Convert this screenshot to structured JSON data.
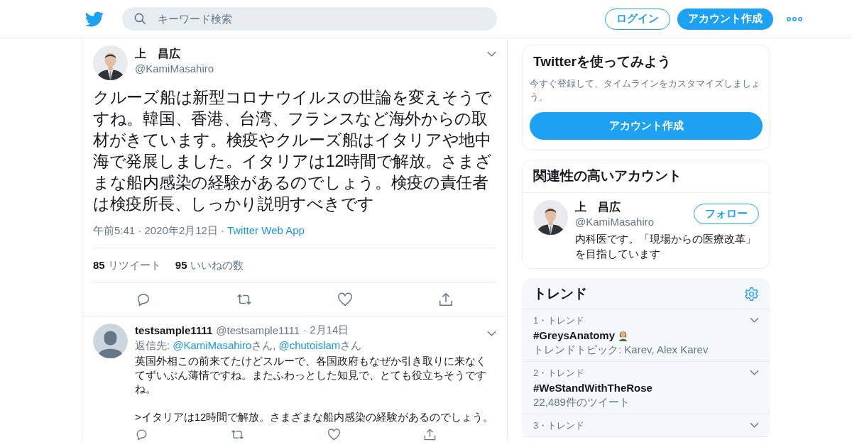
{
  "header": {
    "search": {
      "placeholder": "キーワード検索"
    },
    "login": "ログイン",
    "signup": "アカウント作成"
  },
  "tweet": {
    "name": "上　昌広",
    "handle": "@KamiMasahiro",
    "text": "クルーズ船は新型コロナウイルスの世論を変えそうですね。韓国、香港、台湾、フランスなど海外からの取材がきています。検疫やクルーズ船はイタリアや地中海で発展しました。イタリアは12時間で解放。さまざまな船内感染の経験があるのでしょう。検疫の責任者は検疫所長、しっかり説明すべきです",
    "timestamp": "午前5:41 · 2020年2月12日",
    "separator": "·",
    "source": "Twitter Web App",
    "stats": [
      {
        "count": "85",
        "label": "リツイート"
      },
      {
        "count": "95",
        "label": "いいねの数"
      }
    ]
  },
  "reply": {
    "name": "testsample1111",
    "handle": "@testsample1111",
    "date": "· 2月14日",
    "reply_to": {
      "prefix": "返信先:",
      "mentions": [
        {
          "handle": "@KamiMasahiro",
          "suffix": "さん,"
        },
        {
          "handle": "@chutoislam",
          "suffix": "さん"
        }
      ]
    },
    "paragraphs": [
      "英国外相この前来てたけどスルーで、各国政府もなぜか引き取りに来なくてずいぶん薄情ですね。またふわっとした知見で、とても役立ちそうですね。",
      ">イタリアは12時間で解放。さまざまな船内感染の経験があるのでしょう。"
    ]
  },
  "sidebar": {
    "signup_card": {
      "title": "Twitterを使ってみよう",
      "text": "今すぐ登録して、タイムラインをカスタマイズしましょう。",
      "button": "アカウント作成"
    },
    "related": {
      "title": "関連性の高いアカウント",
      "accounts": [
        {
          "name": "上　昌広",
          "handle": "@KamiMasahiro",
          "bio": "内科医です。「現場からの医療改革」を目指しています",
          "follow": "フォロー"
        }
      ]
    },
    "trends": {
      "title": "トレンド",
      "items": [
        {
          "meta": "1・トレンド",
          "name": "#GreysAnatomy",
          "emoji": true,
          "detail": "トレンドトピック: Karev, Alex Karev"
        },
        {
          "meta": "2・トレンド",
          "name": "#WeStandWithTheRose",
          "emoji": false,
          "detail": "22,489件のツイート"
        },
        {
          "meta": "3・トレンド"
        }
      ]
    }
  }
}
